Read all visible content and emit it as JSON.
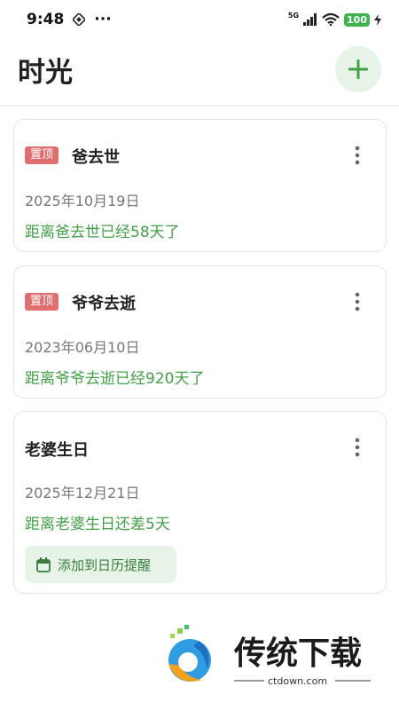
{
  "status_bar": {
    "time": "9:48",
    "dots": "···",
    "network": "5G",
    "battery": "100"
  },
  "header": {
    "title": "时光"
  },
  "events": [
    {
      "title": "爸去世",
      "pinned_label": "置顶",
      "date": "2025年10月19日",
      "countdown": "距离爸去世已经58天了"
    },
    {
      "title": "爷爷去逝",
      "pinned_label": "置顶",
      "date": "2023年06月10日",
      "countdown": "距离爷爷去逝已经920天了"
    },
    {
      "title": "老婆生日",
      "date": "2025年12月21日",
      "countdown": "距离老婆生日还差5天",
      "reminder_button": "添加到日历提醒"
    }
  ],
  "watermark": {
    "brand": "传统下载",
    "site": "ctdown.com"
  },
  "colors": {
    "accent_green": "#43a047",
    "pin_red": "#e07070",
    "soft_green_bg": "#e6f3e6"
  },
  "icons": [
    "plus-icon",
    "more-vertical-icon",
    "calendar-icon",
    "signal-icon",
    "wifi-icon",
    "charging-icon",
    "nfc-icon"
  ]
}
